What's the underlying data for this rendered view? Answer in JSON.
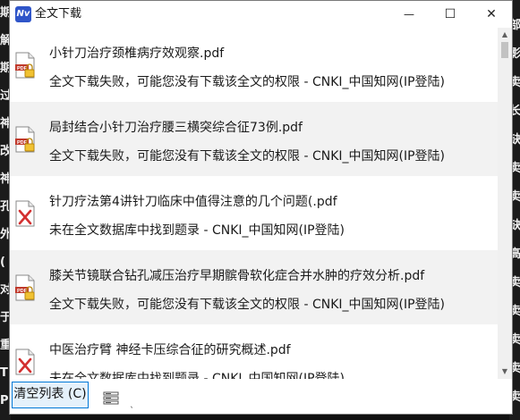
{
  "window": {
    "title": "全文下载",
    "app_icon": "Nv",
    "minimize_glyph": "—",
    "maximize_glyph": "☐",
    "close_glyph": "✕"
  },
  "background": {
    "left_chars": [
      "期",
      "解",
      "期",
      "过",
      "神",
      "改",
      "神",
      "孔",
      "外",
      "(",
      "对",
      "于",
      "重",
      "T",
      "Ps"
    ],
    "right_chars": [
      "部",
      "影",
      "卖",
      "长",
      "缺",
      "卖",
      "卖",
      "缺",
      "高",
      "卖",
      "卖",
      "卖",
      "卖",
      "卖"
    ]
  },
  "items": [
    {
      "name": "小针刀治疗颈椎病疗效观察.pdf",
      "status": "全文下载失败，可能您没有下载该全文的权限  -  CNKI_中国知网(IP登陆)",
      "icon": "pdf-lock-icon"
    },
    {
      "name": "局封结合小针刀治疗腰三横突综合征73例.pdf",
      "status": "全文下载失败，可能您没有下载该全文的权限  -  CNKI_中国知网(IP登陆)",
      "icon": "pdf-lock-icon"
    },
    {
      "name": "针刀疗法第4讲针刀临床中值得注意的几个问题(.pdf",
      "status": "未在全文数据库中找到题录  -  CNKI_中国知网(IP登陆)",
      "icon": "file-error-icon"
    },
    {
      "name": "膝关节镜联合钻孔减压治疗早期髌骨软化症合并水肿的疗效分析.pdf",
      "status": "全文下载失败，可能您没有下载该全文的权限  -  CNKI_中国知网(IP登陆)",
      "icon": "pdf-lock-icon"
    },
    {
      "name": "中医治疗臂 神经卡压综合征的研究概述.pdf",
      "status": "未在全文数据库中找到题录  -  CNKI_中国知网(IP登陆)",
      "icon": "file-error-icon"
    }
  ],
  "footer": {
    "clear_button": "清空列表 (C)",
    "tool_icon": "list-settings-icon"
  }
}
